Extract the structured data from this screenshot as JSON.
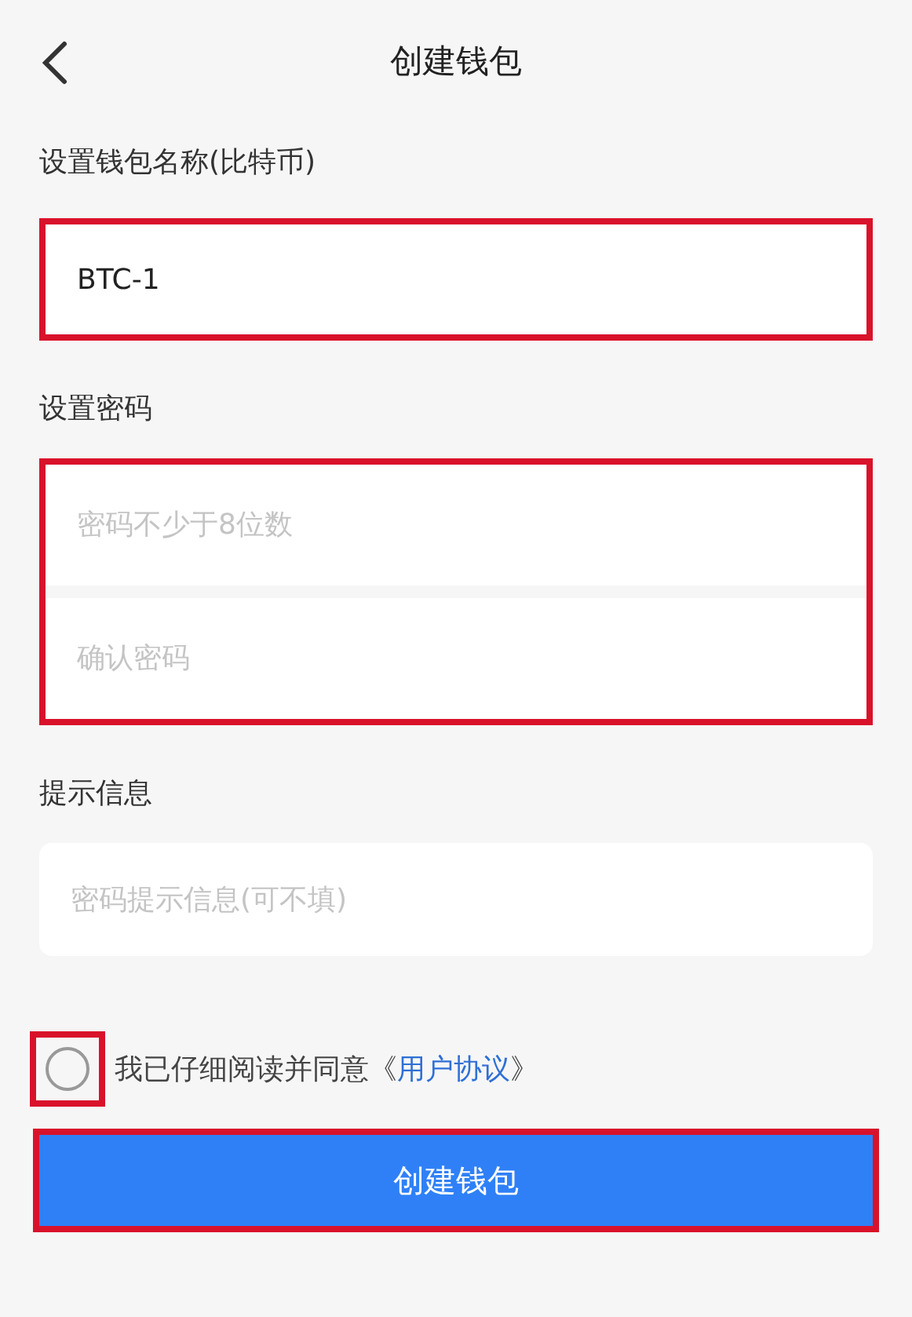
{
  "header": {
    "title": "创建钱包"
  },
  "name_section": {
    "label": "设置钱包名称(比特币)",
    "highlighted": true,
    "field": {
      "value": "BTC-1"
    }
  },
  "password_section": {
    "label": "设置密码",
    "highlighted": true,
    "fields": [
      {
        "placeholder": "密码不少于8位数"
      },
      {
        "placeholder": "确认密码"
      }
    ]
  },
  "hint_section": {
    "label": "提示信息",
    "field": {
      "placeholder": "密码提示信息(可不填)"
    }
  },
  "agreement": {
    "checked": false,
    "highlighted": true,
    "text": "我已仔细阅读并同意《",
    "link": "用户协议",
    "text_end": "》"
  },
  "submit_button": {
    "label": "创建钱包",
    "highlighted": true
  }
}
